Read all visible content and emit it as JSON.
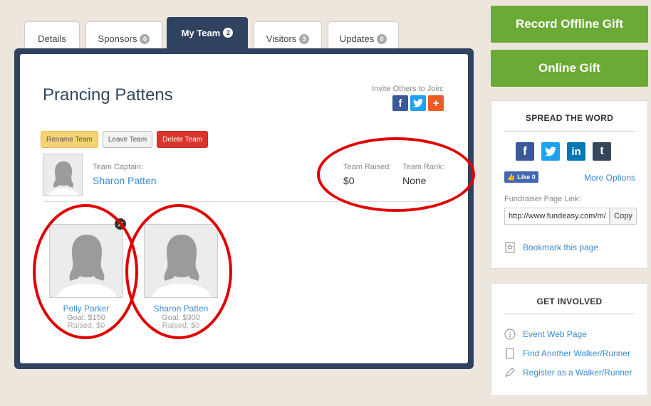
{
  "tabs": [
    {
      "label": "Details",
      "badge": ""
    },
    {
      "label": "Sponsors",
      "badge": "0"
    },
    {
      "label": "My Team",
      "badge": "2"
    },
    {
      "label": "Visitors",
      "badge": "3"
    },
    {
      "label": "Updates",
      "badge": "0"
    }
  ],
  "team": {
    "name": "Prancing Pattens",
    "invite_label": "Invite Others to Join:",
    "buttons": {
      "rename": "Rename Team",
      "leave": "Leave Team",
      "delete": "Delete Team"
    },
    "captain_label": "Team Captain:",
    "captain_name": "Sharon Patten",
    "raised_label": "Team Raised:",
    "raised_value": "$0",
    "rank_label": "Team Rank:",
    "rank_value": "None"
  },
  "members": [
    {
      "name": "Polly Parker",
      "goal": "Goal: $150",
      "raised": "Raised: $0"
    },
    {
      "name": "Sharon Patten",
      "goal": "Goal: $300",
      "raised": "Raised: $0"
    }
  ],
  "actions": {
    "offline_gift": "Record Offline Gift",
    "online_gift": "Online Gift"
  },
  "spread": {
    "title": "SPREAD THE WORD",
    "like": "Like 0",
    "more_options": "More Options",
    "page_link_label": "Fundraiser Page Link:",
    "page_link_value": "http://www.fundeasy.com/m/",
    "copy": "Copy",
    "bookmark": "Bookmark this page"
  },
  "involved": {
    "title": "GET INVOLVED",
    "items": [
      "Event Web Page",
      "Find Another Walker/Runner",
      "Register as a Walker/Runner"
    ]
  },
  "colors": {
    "brand_navy": "#2f4361",
    "green": "#6aaa35",
    "link": "#3a8ad4",
    "annotation": "#e00000"
  }
}
